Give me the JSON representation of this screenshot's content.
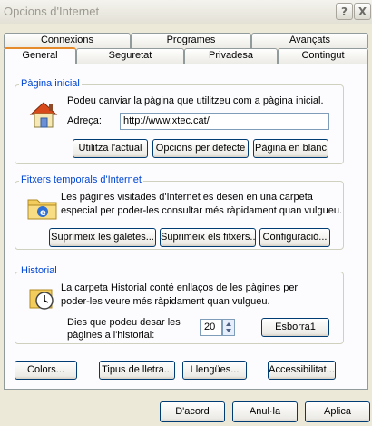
{
  "window": {
    "title": "Opcions d'Internet",
    "help_label": "?",
    "close_label": "X"
  },
  "tabs": {
    "row1": [
      "Connexions",
      "Programes",
      "Avançats"
    ],
    "row2": [
      "General",
      "Seguretat",
      "Privadesa",
      "Contingut"
    ],
    "active": "General"
  },
  "home_page": {
    "legend": "Pàgina inicial",
    "description": "Podeu canviar la pàgina que utilitzeu com a pàgina inicial.",
    "address_label": "Adreça:",
    "address_value": "http://www.xtec.cat/",
    "buttons": {
      "use_current": "Utilitza l'actual",
      "use_default": "Opcions per defecte",
      "use_blank": "Pàgina en blanc"
    }
  },
  "temp_files": {
    "legend": "Fitxers temporals d'Internet",
    "description_line1": "Les pàgines visitades d'Internet es desen en una carpeta",
    "description_line2": "especial per poder-les consultar més ràpidament quan vulgueu.",
    "buttons": {
      "delete_cookies": "Suprimeix les galetes...",
      "delete_files": "Suprimeix els fitxers...",
      "settings": "Configuració..."
    }
  },
  "history": {
    "legend": "Historial",
    "description_line1": "La carpeta Historial conté enllaços de les pàgines per",
    "description_line2": "poder-les veure més ràpidament quan vulgueu.",
    "days_label_line1": "Dies que podeu desar les",
    "days_label_line2": "pàgines a l'historial:",
    "days_value": "20",
    "clear_button": "Esborra1"
  },
  "bottom_buttons": {
    "colors": "Colors...",
    "fonts": "Tipus de lletra...",
    "languages": "Llengües...",
    "accessibility": "Accessibilitat..."
  },
  "dialog_buttons": {
    "ok": "D'acord",
    "cancel": "Anul·la",
    "apply": "Aplica"
  },
  "colors": {
    "face": "#ece9d8",
    "panel": "#fcfcfe",
    "legend": "#0046d5",
    "button_border": "#003c74",
    "active_tab_accent": "#e68b2c"
  }
}
